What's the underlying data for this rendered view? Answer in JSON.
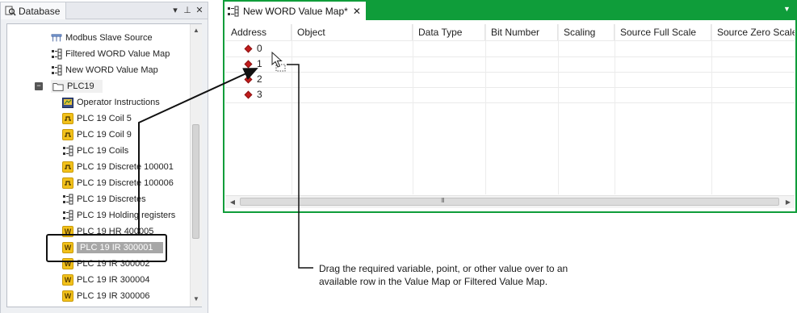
{
  "database_panel": {
    "title": "Database",
    "controls": {
      "dropdown": "▾",
      "pin": "⊥",
      "close": "✕"
    },
    "items": [
      {
        "label": "Modbus Slave Source",
        "icon": "modbus-source-icon"
      },
      {
        "label": "Filtered WORD Value Map",
        "icon": "value-map-icon"
      },
      {
        "label": "New WORD Value Map",
        "icon": "value-map-icon"
      },
      {
        "label": "PLC19",
        "icon": "folder-icon"
      },
      {
        "label": "Operator Instructions",
        "icon": "instructions-icon"
      },
      {
        "label": "PLC 19 Coil 5",
        "icon": "coil-icon"
      },
      {
        "label": "PLC 19 Coil 9",
        "icon": "coil-icon"
      },
      {
        "label": "PLC 19 Coils",
        "icon": "value-map-icon"
      },
      {
        "label": "PLC 19 Discrete 100001",
        "icon": "coil-icon"
      },
      {
        "label": "PLC 19 Discrete 100006",
        "icon": "coil-icon"
      },
      {
        "label": "PLC 19 Discretes",
        "icon": "value-map-icon"
      },
      {
        "label": "PLC 19 Holding registers",
        "icon": "value-map-icon"
      },
      {
        "label": "PLC 19 HR 400005",
        "icon": "word-icon"
      },
      {
        "label": "PLC 19 IR 300001",
        "icon": "word-icon"
      },
      {
        "label": "PLC 19 IR 300002",
        "icon": "word-icon"
      },
      {
        "label": "PLC 19 IR 300004",
        "icon": "word-icon"
      },
      {
        "label": "PLC 19 IR 300006",
        "icon": "word-icon"
      }
    ],
    "word_badge": "W"
  },
  "value_map": {
    "tab_title": "New WORD Value Map*",
    "columns": [
      "Address",
      "Object",
      "Data Type",
      "Bit Number",
      "Scaling",
      "Source Full Scale",
      "Source Zero Scale"
    ],
    "rows": [
      {
        "address": "0"
      },
      {
        "address": "1"
      },
      {
        "address": "2"
      },
      {
        "address": "3"
      }
    ],
    "scroll_grip": "III"
  },
  "annotation": {
    "text": "Drag the required variable, point, or other value over to an available row in the Value Map or Filtered Value Map."
  },
  "colors": {
    "accent": "#0f9d3a",
    "selection": "#a7a7a7",
    "row_marker": "#c21c1c"
  }
}
